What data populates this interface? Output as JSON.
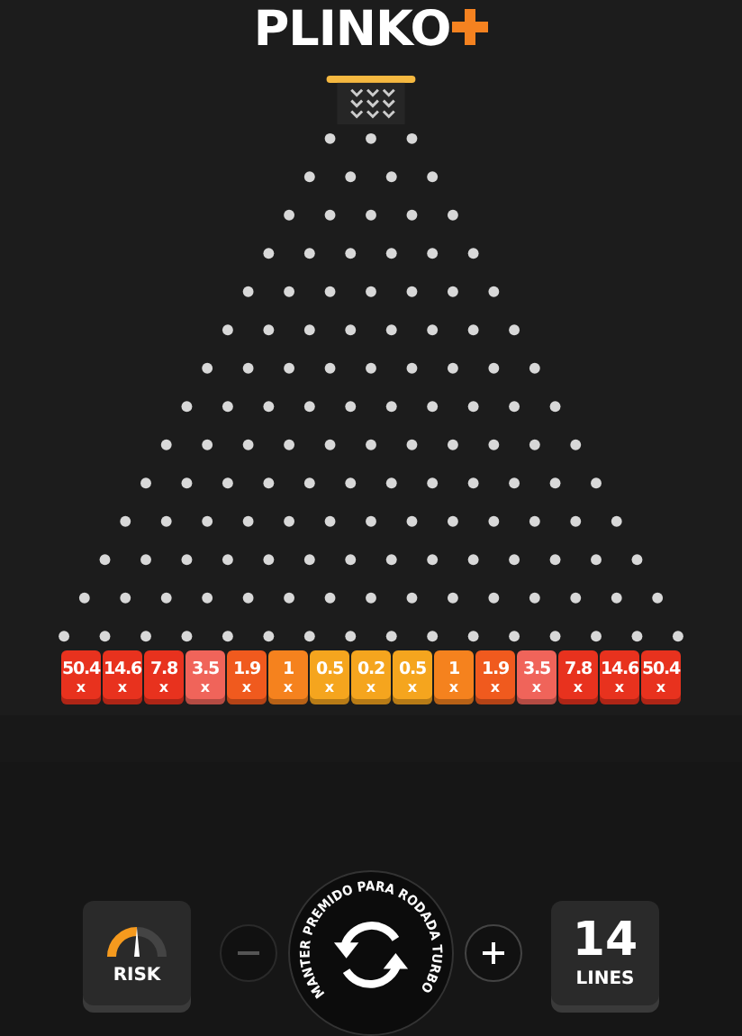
{
  "logo": {
    "text": "PLINKO"
  },
  "slots": [
    {
      "value": "50.4",
      "mark": "x",
      "color": "#e8321e"
    },
    {
      "value": "14.6",
      "mark": "x",
      "color": "#e8321e"
    },
    {
      "value": "7.8",
      "mark": "x",
      "color": "#e8321e"
    },
    {
      "value": "3.5",
      "mark": "x",
      "color": "#f0645a"
    },
    {
      "value": "1.9",
      "mark": "x",
      "color": "#f05a1e"
    },
    {
      "value": "1",
      "mark": "x",
      "color": "#f5821e"
    },
    {
      "value": "0.5",
      "mark": "x",
      "color": "#f5a51e"
    },
    {
      "value": "0.2",
      "mark": "x",
      "color": "#f5a51e"
    },
    {
      "value": "0.5",
      "mark": "x",
      "color": "#f5a51e"
    },
    {
      "value": "1",
      "mark": "x",
      "color": "#f5821e"
    },
    {
      "value": "1.9",
      "mark": "x",
      "color": "#f05a1e"
    },
    {
      "value": "3.5",
      "mark": "x",
      "color": "#f0645a"
    },
    {
      "value": "7.8",
      "mark": "x",
      "color": "#e8321e"
    },
    {
      "value": "14.6",
      "mark": "x",
      "color": "#e8321e"
    },
    {
      "value": "50.4",
      "mark": "x",
      "color": "#e8321e"
    }
  ],
  "controls": {
    "risk_label": "RISK",
    "turbo_hint": "MANTER PREMIDO PARA RODADA TURBO",
    "lines_value": "14",
    "lines_label": "LINES"
  }
}
